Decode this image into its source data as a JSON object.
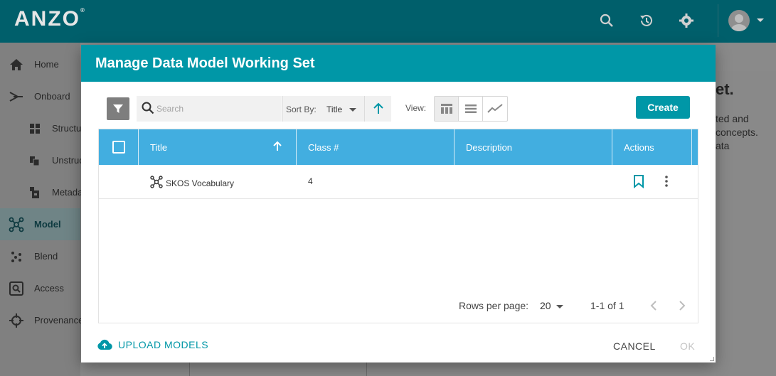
{
  "app": {
    "logo_text": "ANZO",
    "logo_mark": "®",
    "header_icons": [
      "search-icon",
      "history-icon",
      "gear-icon",
      "avatar",
      "chevron-down-icon"
    ]
  },
  "sidebar": {
    "items": [
      {
        "label": "Home",
        "icon": "home-icon"
      },
      {
        "label": "Onboard",
        "icon": "onboard-icon"
      },
      {
        "label": "Structu",
        "icon": "grid-icon"
      },
      {
        "label": "Unstruc",
        "icon": "documents-icon"
      },
      {
        "label": "Metada",
        "icon": "metadata-icon"
      },
      {
        "label": "Model",
        "icon": "graph-icon",
        "active": true
      },
      {
        "label": "Blend",
        "icon": "blend-icon"
      },
      {
        "label": "Access",
        "icon": "access-icon"
      },
      {
        "label": "Provenance",
        "icon": "crosshair-icon"
      }
    ]
  },
  "background": {
    "heading": "et.",
    "lines": [
      "ted and",
      "concepts.",
      "ata"
    ]
  },
  "modal": {
    "title": "Manage Data Model Working Set",
    "search": {
      "placeholder": "Search",
      "value": ""
    },
    "sort": {
      "label": "Sort By:",
      "value": "Title",
      "direction": "ascending"
    },
    "view": {
      "label": "View:",
      "options": [
        "table-icon",
        "list-icon",
        "chart-icon"
      ],
      "selected": "table-icon"
    },
    "create_label": "Create",
    "table": {
      "columns": [
        "Title",
        "Class #",
        "Description",
        "Actions"
      ],
      "rows": [
        {
          "title": "SKOS Vocabulary",
          "class_count": "4",
          "description": ""
        }
      ]
    },
    "pagination": {
      "rows_per_page_label": "Rows per page:",
      "rows_per_page": "20",
      "range": "1-1 of 1"
    },
    "upload_label": "UPLOAD MODELS",
    "cancel_label": "CANCEL",
    "ok_label": "OK"
  },
  "colors": {
    "header_teal": "#005f6b",
    "modal_header": "#0097a7",
    "table_header": "#42aee0",
    "accent": "#0097a7"
  }
}
